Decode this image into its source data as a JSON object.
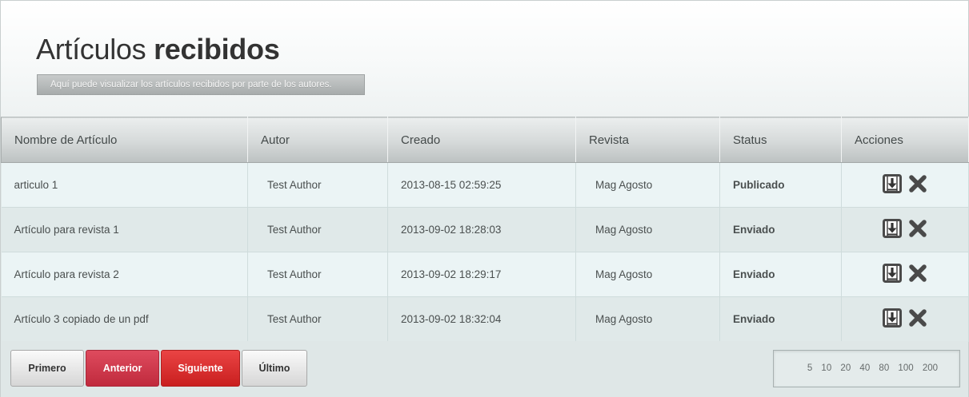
{
  "header": {
    "title_light": "Artículos",
    "title_bold": "recibidos",
    "subtitle": "Aquí puede visualizar los artículos recibidos por parte de los autores."
  },
  "table": {
    "columns": [
      "Nombre de Artículo",
      "Autor",
      "Creado",
      "Revista",
      "Status",
      "Acciones"
    ],
    "rows": [
      {
        "name": "articulo 1",
        "author": "Test Author",
        "created": "2013-08-15 02:59:25",
        "magazine": "Mag Agosto",
        "status": "Publicado"
      },
      {
        "name": "Artículo para revista 1",
        "author": "Test Author",
        "created": "2013-09-02 18:28:03",
        "magazine": "Mag Agosto",
        "status": "Enviado"
      },
      {
        "name": "Artículo para revista 2",
        "author": "Test Author",
        "created": "2013-09-02 18:29:17",
        "magazine": "Mag Agosto",
        "status": "Enviado"
      },
      {
        "name": "Artículo 3 copiado de un pdf",
        "author": "Test Author",
        "created": "2013-09-02 18:32:04",
        "magazine": "Mag Agosto",
        "status": "Enviado"
      }
    ],
    "row_actions": [
      "download-icon",
      "delete-icon"
    ]
  },
  "pagination": {
    "first": "Primero",
    "prev": "Anterior",
    "next": "Siguiente",
    "last": "Último",
    "page_sizes": [
      "5",
      "10",
      "20",
      "40",
      "80",
      "100",
      "200"
    ]
  },
  "colors": {
    "prev_button": "#cf3a4d",
    "next_button": "#e03333",
    "row_odd": "#ebf4f5",
    "row_even": "#e0e9e9"
  }
}
